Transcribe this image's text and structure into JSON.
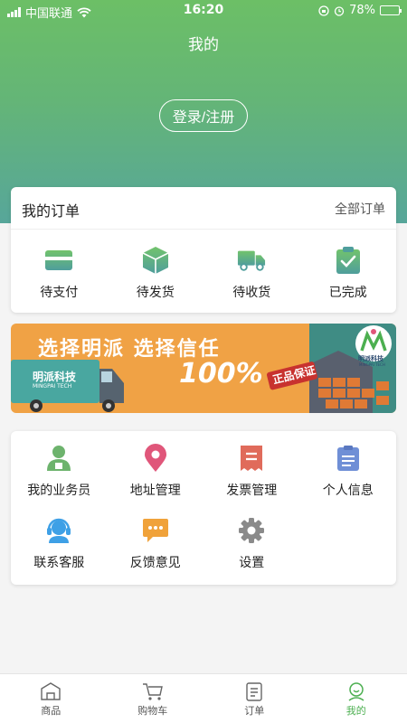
{
  "status": {
    "carrier": "中国联通",
    "time": "16:20",
    "battery": "78%",
    "battery_level": 0.78
  },
  "header": {
    "title": "我的",
    "login_label": "登录/注册"
  },
  "orders": {
    "title": "我的订单",
    "all_label": "全部订单",
    "items": [
      {
        "label": "待支付",
        "icon": "card-icon"
      },
      {
        "label": "待发货",
        "icon": "box-icon"
      },
      {
        "label": "待收货",
        "icon": "truck-icon"
      },
      {
        "label": "已完成",
        "icon": "clipboard-check-icon"
      }
    ]
  },
  "banner": {
    "headline": "选择明派 选择信任",
    "percent": "100%",
    "stamp": "正品保证",
    "brand": "明派科技",
    "brand_en": "MINGPAI TECH",
    "colors": {
      "orange": "#f0a245",
      "teal": "#3f8c84"
    }
  },
  "services": {
    "items": [
      {
        "label": "我的业务员",
        "icon": "salesperson-icon",
        "color": "#6db36d"
      },
      {
        "label": "地址管理",
        "icon": "location-pin-icon",
        "color": "#e0567a"
      },
      {
        "label": "发票管理",
        "icon": "invoice-icon",
        "color": "#e06b5b"
      },
      {
        "label": "个人信息",
        "icon": "profile-doc-icon",
        "color": "#6f8fd6"
      },
      {
        "label": "联系客服",
        "icon": "headset-icon",
        "color": "#3ea0e6"
      },
      {
        "label": "反馈意见",
        "icon": "feedback-icon",
        "color": "#f0a23a"
      },
      {
        "label": "设置",
        "icon": "gear-icon",
        "color": "#8a8a8a"
      }
    ]
  },
  "tabbar": {
    "active_color": "#4caf50",
    "items": [
      {
        "label": "商品",
        "icon": "store-icon"
      },
      {
        "label": "购物车",
        "icon": "cart-icon"
      },
      {
        "label": "订单",
        "icon": "order-icon"
      },
      {
        "label": "我的",
        "icon": "user-face-icon",
        "active": true
      }
    ]
  }
}
